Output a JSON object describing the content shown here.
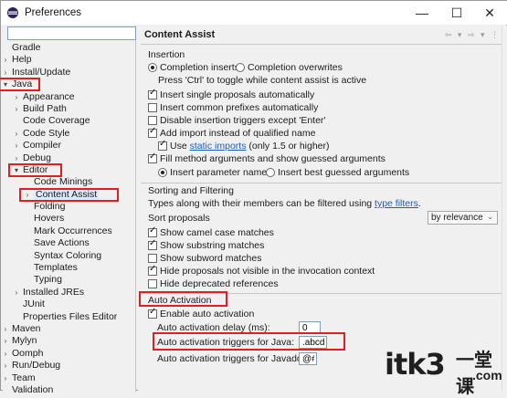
{
  "window": {
    "title": "Preferences"
  },
  "left": {
    "filter_value": "",
    "tree": [
      {
        "label": "Gradle",
        "level": 0,
        "arrow": ""
      },
      {
        "label": "Help",
        "level": 0,
        "arrow": "›"
      },
      {
        "label": "Install/Update",
        "level": 0,
        "arrow": "›"
      },
      {
        "label": "Java",
        "level": 0,
        "arrow": "⌄",
        "red": true
      },
      {
        "label": "Appearance",
        "level": 1,
        "arrow": "›"
      },
      {
        "label": "Build Path",
        "level": 1,
        "arrow": "›"
      },
      {
        "label": "Code Coverage",
        "level": 1,
        "arrow": ""
      },
      {
        "label": "Code Style",
        "level": 1,
        "arrow": "›"
      },
      {
        "label": "Compiler",
        "level": 1,
        "arrow": "›"
      },
      {
        "label": "Debug",
        "level": 1,
        "arrow": "›"
      },
      {
        "label": "Editor",
        "level": 1,
        "arrow": "⌄",
        "red": true
      },
      {
        "label": "Code Minings",
        "level": 2,
        "arrow": ""
      },
      {
        "label": "Content Assist",
        "level": 2,
        "arrow": "›",
        "red": true,
        "selected": true
      },
      {
        "label": "Folding",
        "level": 2,
        "arrow": ""
      },
      {
        "label": "Hovers",
        "level": 2,
        "arrow": ""
      },
      {
        "label": "Mark Occurrences",
        "level": 2,
        "arrow": ""
      },
      {
        "label": "Save Actions",
        "level": 2,
        "arrow": ""
      },
      {
        "label": "Syntax Coloring",
        "level": 2,
        "arrow": ""
      },
      {
        "label": "Templates",
        "level": 2,
        "arrow": ""
      },
      {
        "label": "Typing",
        "level": 2,
        "arrow": ""
      },
      {
        "label": "Installed JREs",
        "level": 1,
        "arrow": "›"
      },
      {
        "label": "JUnit",
        "level": 1,
        "arrow": ""
      },
      {
        "label": "Properties Files Editor",
        "level": 1,
        "arrow": ""
      },
      {
        "label": "Maven",
        "level": 0,
        "arrow": "›"
      },
      {
        "label": "Mylyn",
        "level": 0,
        "arrow": "›"
      },
      {
        "label": "Oomph",
        "level": 0,
        "arrow": "›"
      },
      {
        "label": "Run/Debug",
        "level": 0,
        "arrow": "›"
      },
      {
        "label": "Team",
        "level": 0,
        "arrow": "›"
      },
      {
        "label": "Validation",
        "level": 0,
        "arrow": ""
      }
    ]
  },
  "right": {
    "title": "Content Assist",
    "insertion": {
      "title": "Insertion",
      "completion_inserts": "Completion inserts",
      "completion_overwrites": "Completion overwrites",
      "ctrl_hint": "Press 'Ctrl' to toggle while content assist is active",
      "insert_single": "Insert single proposals automatically",
      "insert_common": "Insert common prefixes automatically",
      "disable_triggers": "Disable insertion triggers except 'Enter'",
      "add_import": "Add import instead of qualified name",
      "use_label": "Use",
      "static_imports": "static imports",
      "only_15": "(only 1.5 or higher)",
      "fill_method": "Fill method arguments and show guessed arguments",
      "insert_param_names": "Insert parameter names",
      "insert_best_guessed": "Insert best guessed arguments"
    },
    "sorting": {
      "title": "Sorting and Filtering",
      "types_text": "Types along with their members can be filtered using",
      "type_filters": "type filters",
      "period": ".",
      "sort_proposals": "Sort proposals",
      "sort_value": "by relevance",
      "show_camel": "Show camel case matches",
      "show_substring": "Show substring matches",
      "show_subword": "Show subword matches",
      "hide_invocation": "Hide proposals not visible in the invocation context",
      "hide_deprecated": "Hide deprecated references"
    },
    "auto": {
      "title": "Auto Activation",
      "enable": "Enable auto activation",
      "delay_label": "Auto activation delay (ms):",
      "delay_value": "0",
      "java_label": "Auto activation triggers for Java:",
      "java_value": ".abcd",
      "javadoc_label": "Auto activation triggers for Javadoc:",
      "javadoc_value": "@#"
    }
  },
  "watermark": {
    "text": "itk3",
    "cn": "一堂课",
    "domain": ".com"
  },
  "colors": {
    "accent_red": "#e02020",
    "link": "#1a5fb4"
  }
}
